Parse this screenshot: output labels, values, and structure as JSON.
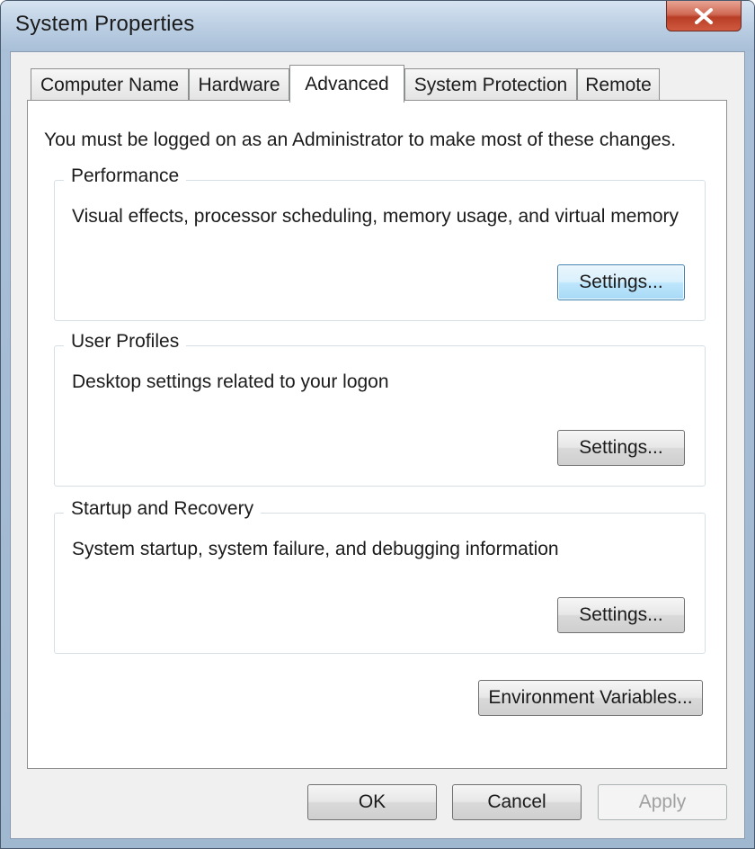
{
  "window": {
    "title": "System Properties"
  },
  "tabs": [
    {
      "label": "Computer Name",
      "active": false
    },
    {
      "label": "Hardware",
      "active": false
    },
    {
      "label": "Advanced",
      "active": true
    },
    {
      "label": "System Protection",
      "active": false
    },
    {
      "label": "Remote",
      "active": false
    }
  ],
  "advanced": {
    "admin_note": "You must be logged on as an Administrator to make most of these changes.",
    "performance": {
      "title": "Performance",
      "description": "Visual effects, processor scheduling, memory usage, and virtual memory",
      "button": "Settings..."
    },
    "user_profiles": {
      "title": "User Profiles",
      "description": "Desktop settings related to your logon",
      "button": "Settings..."
    },
    "startup_recovery": {
      "title": "Startup and Recovery",
      "description": "System startup, system failure, and debugging information",
      "button": "Settings..."
    },
    "environment_button": "Environment Variables..."
  },
  "footer": {
    "ok": "OK",
    "cancel": "Cancel",
    "apply": "Apply"
  },
  "icons": {
    "close": "close-icon"
  }
}
